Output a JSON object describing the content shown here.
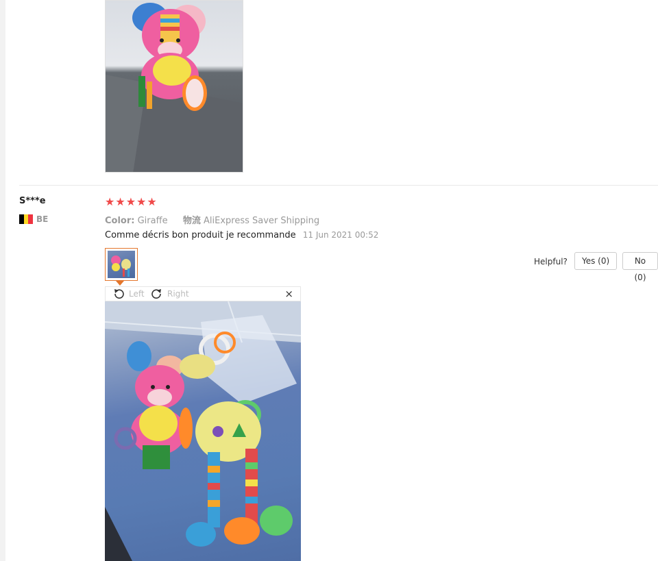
{
  "review": {
    "reviewer": "S***e",
    "country": "BE",
    "rating": "★★★★★",
    "color_label": "Color:",
    "color_value": "Giraffe",
    "logistics_label": "物流",
    "logistics_value": "AliExpress Saver Shipping",
    "comment": "Comme décris bon produit je recommande",
    "date": "11 Jun 2021 00:52",
    "helpful_label": "Helpful?",
    "yes_label": "Yes (0)",
    "no_label": "No (0)"
  },
  "viewer": {
    "rotate_left": "Left",
    "rotate_right": "Right",
    "close": "×"
  },
  "colors": {
    "star": "#f04a4a",
    "thumb_border": "#e4762c",
    "flag": [
      "#000000",
      "#fdda24",
      "#ef3340"
    ]
  }
}
